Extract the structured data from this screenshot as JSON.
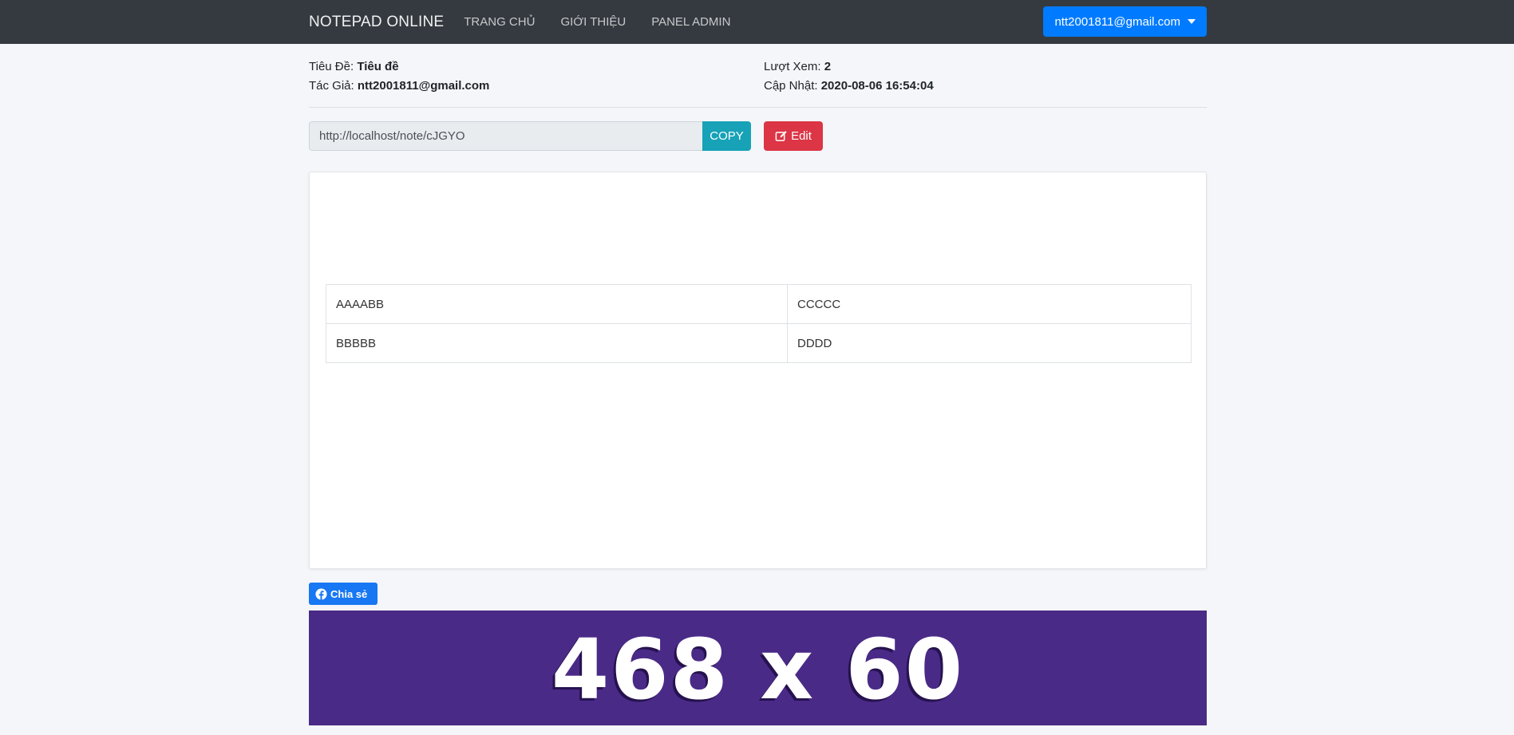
{
  "navbar": {
    "brand": "NOTEPAD ONLINE",
    "links": [
      "TRANG CHỦ",
      "GIỚI THIỆU",
      "PANEL ADMIN"
    ],
    "user": "ntt2001811@gmail.com",
    "bg_color": "#343a40"
  },
  "meta": {
    "title_label": "Tiêu Đề: ",
    "title_value": "Tiêu đề",
    "author_label": "Tác Giả: ",
    "author_value": "ntt2001811@gmail.com",
    "views_label": "Lượt Xem: ",
    "views_value": "2",
    "updated_label": "Cập Nhật: ",
    "updated_value": "2020-08-06 16:54:04"
  },
  "linkbar": {
    "url": "http://localhost/note/cJGYO",
    "copy_label": "COPY",
    "edit_label": "Edit",
    "copy_color": "#17a2b8",
    "edit_color": "#dc3545"
  },
  "note": {
    "rows": [
      [
        "AAAABB",
        "CCCCC"
      ],
      [
        "BBBBB",
        "DDDD"
      ]
    ]
  },
  "share": {
    "label": "Chia sẻ",
    "color": "#1877f2"
  },
  "ad": {
    "text": "468 x 60",
    "bg_color": "#4a2a87"
  }
}
